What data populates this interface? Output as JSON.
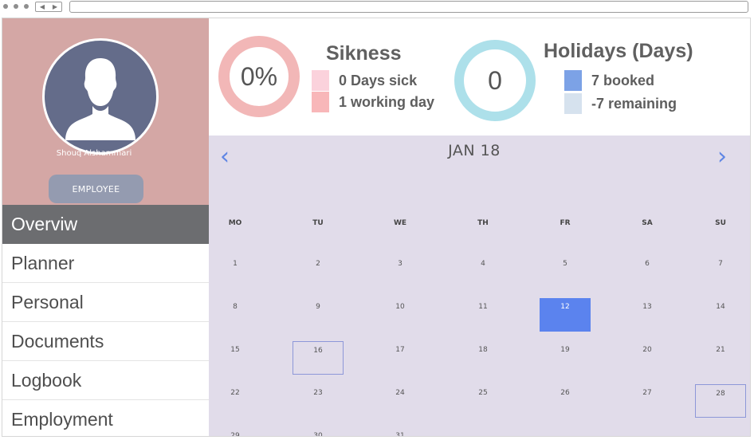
{
  "profile": {
    "name": "Shouq Alshammari",
    "role": "EMPLOYEE"
  },
  "nav": {
    "items": [
      {
        "label": "Overviw",
        "active": true
      },
      {
        "label": "Planner",
        "active": false
      },
      {
        "label": "Personal",
        "active": false
      },
      {
        "label": "Documents",
        "active": false
      },
      {
        "label": "Logbook",
        "active": false
      },
      {
        "label": "Employment",
        "active": false
      }
    ]
  },
  "sickness": {
    "percent": "0%",
    "title": "Sikness",
    "legend": [
      {
        "label": "0 Days sick",
        "color": "#fbd2dc"
      },
      {
        "label": "1 working day",
        "color": "#f8b7b9"
      }
    ],
    "ring_color": "#f2b7b7"
  },
  "holidays": {
    "value": "0",
    "title": "Holidays (Days)",
    "legend": [
      {
        "label": "7 booked",
        "color": "#7ca2e6"
      },
      {
        "label": "-7 remaining",
        "color": "#d6e2ee"
      }
    ],
    "ring_color": "#ade0ea"
  },
  "calendar": {
    "month_label": "JAN 18",
    "prev_icon": "chevron-left-icon",
    "next_icon": "chevron-right-icon",
    "weekdays": [
      "MO",
      "TU",
      "WE",
      "TH",
      "FR",
      "SA",
      "SU"
    ],
    "weeks": [
      [
        "1",
        "2",
        "3",
        "4",
        "5",
        "6",
        "7"
      ],
      [
        "8",
        "9",
        "10",
        "11",
        "12",
        "13",
        "14"
      ],
      [
        "15",
        "16",
        "17",
        "18",
        "19",
        "20",
        "21"
      ],
      [
        "22",
        "23",
        "24",
        "25",
        "26",
        "27",
        "28"
      ],
      [
        "29",
        "30",
        "31",
        "",
        "",
        "",
        ""
      ]
    ],
    "selected_day": "12",
    "outlined_days": [
      "16",
      "28"
    ],
    "accent_color": "#5b83ee"
  },
  "colors": {
    "profile_bg": "#d4a7a5",
    "nav_active_bg": "#6c6d70",
    "calendar_bg": "#e1dcea"
  }
}
